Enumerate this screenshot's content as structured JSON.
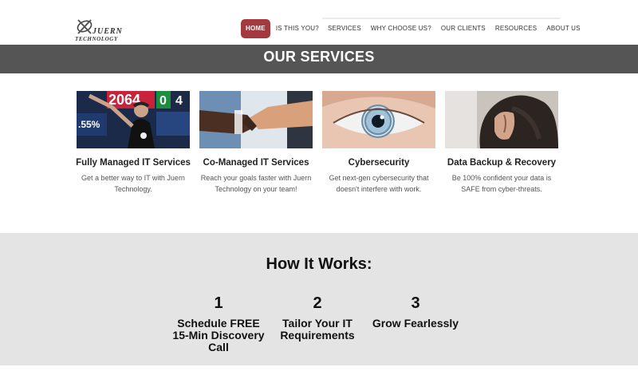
{
  "logo": {
    "line1": "JUERN",
    "line2": "TECHNOLOGY"
  },
  "nav": {
    "items": [
      {
        "label": "HOME",
        "active": true
      },
      {
        "label": "IS THIS YOU?"
      },
      {
        "label": "SERVICES"
      },
      {
        "label": "WHY CHOOSE US?"
      },
      {
        "label": "OUR CLIENTS"
      },
      {
        "label": "RESOURCES"
      },
      {
        "label": "ABOUT US"
      }
    ]
  },
  "banner": {
    "title": "OUR SERVICES"
  },
  "services": [
    {
      "title": "Fully Managed IT Services",
      "description": "Get a better way to IT with Juern Technology."
    },
    {
      "title": "Co-Managed IT Services",
      "description": "Reach your goals faster with Juern Technology on your team!"
    },
    {
      "title": "Cybersecurity",
      "description": "Get next-gen cybersecurity that doesn't interfere with work."
    },
    {
      "title": "Data Backup & Recovery",
      "description": "Be 100% confident your data is SAFE from cyber-threats."
    }
  ],
  "service_images": {
    "screen_numbers": [
      "2064",
      "0",
      "4"
    ],
    "screen_percent": ".55%"
  },
  "how_it_works": {
    "title": "How It Works:",
    "steps": [
      {
        "number": "1",
        "text": "Schedule FREE 15-Min Discovery Call"
      },
      {
        "number": "2",
        "text": "Tailor Your IT Requirements"
      },
      {
        "number": "3",
        "text": "Grow Fearlessly"
      }
    ]
  },
  "colors": {
    "accent": "#a33a3f",
    "banner_bg": "#555555",
    "how_bg": "#e4e4e4"
  }
}
